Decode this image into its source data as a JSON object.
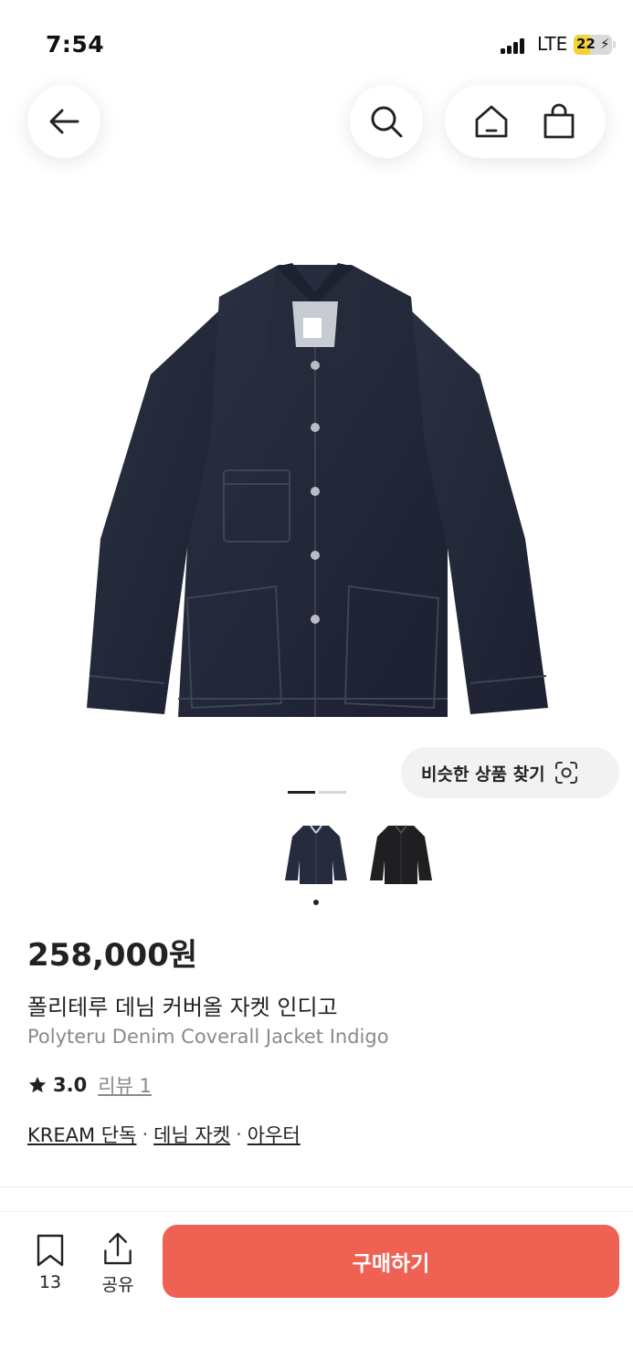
{
  "status_bar": {
    "time": "7:54",
    "network": "LTE",
    "battery": "22"
  },
  "nav": {
    "icons": [
      "back-arrow-icon",
      "search-icon",
      "home-icon",
      "shopping-bag-icon"
    ]
  },
  "gallery": {
    "similar_label": "비슷한 상품 찾기",
    "image_count": 2,
    "active_index": 1
  },
  "product": {
    "price": "258,000원",
    "name_ko": "폴리테루 데님 커버올 자켓 인디고",
    "name_en": "Polyteru Denim Coverall Jacket Indigo",
    "rating": "3.0",
    "review_label": "리뷰 1",
    "tags": [
      "KREAM 단독",
      "데님 자켓",
      "아우터"
    ],
    "tag_separator": "·"
  },
  "bottom_bar": {
    "bookmark_count": "13",
    "share_label": "공유",
    "buy_label": "구매하기"
  },
  "colors": {
    "accent": "#ef6253",
    "denim": "#232838",
    "muted_text": "#8a8a8a"
  }
}
